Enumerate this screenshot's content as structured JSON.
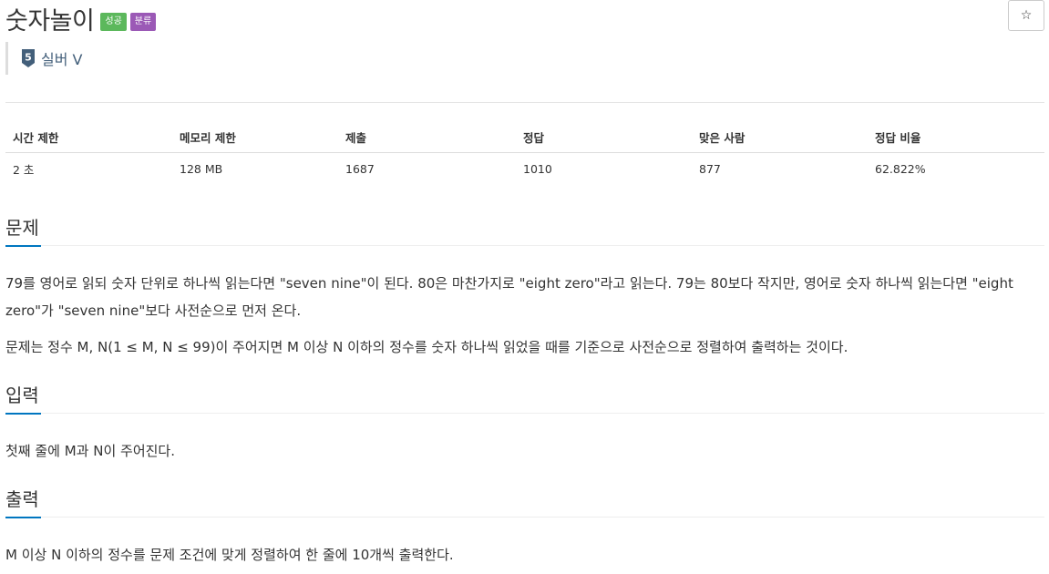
{
  "problem": {
    "title": "숫자놀이",
    "badges": {
      "success": "성공",
      "tag": "분류"
    },
    "star": "☆",
    "tier": {
      "label": "실버 V",
      "level": "5",
      "icon": "silver-tier-icon",
      "color": "#435f7a"
    }
  },
  "info_table": {
    "headers": [
      "시간 제한",
      "메모리 제한",
      "제출",
      "정답",
      "맞은 사람",
      "정답 비율"
    ],
    "values": [
      "2 초",
      "128 MB",
      "1687",
      "1010",
      "877",
      "62.822%"
    ]
  },
  "sections": {
    "problem": {
      "title": "문제",
      "paragraphs": [
        "79를 영어로 읽되 숫자 단위로 하나씩 읽는다면 \"seven nine\"이 된다. 80은 마찬가지로 \"eight zero\"라고 읽는다. 79는 80보다 작지만, 영어로 숫자 하나씩 읽는다면 \"eight zero\"가 \"seven nine\"보다 사전순으로 먼저 온다.",
        "문제는 정수 M, N(1 ≤ M, N ≤ 99)이 주어지면 M 이상 N 이하의 정수를 숫자 하나씩 읽었을 때를 기준으로 사전순으로 정렬하여 출력하는 것이다."
      ]
    },
    "input": {
      "title": "입력",
      "text": "첫째 줄에 M과 N이 주어진다."
    },
    "output": {
      "title": "출력",
      "text": "M 이상 N 이하의 정수를 문제 조건에 맞게 정렬하여 한 줄에 10개씩 출력한다."
    }
  },
  "colors": {
    "success": "#5cb85c",
    "tag": "#9b59b6",
    "accent": "#0076c0"
  }
}
